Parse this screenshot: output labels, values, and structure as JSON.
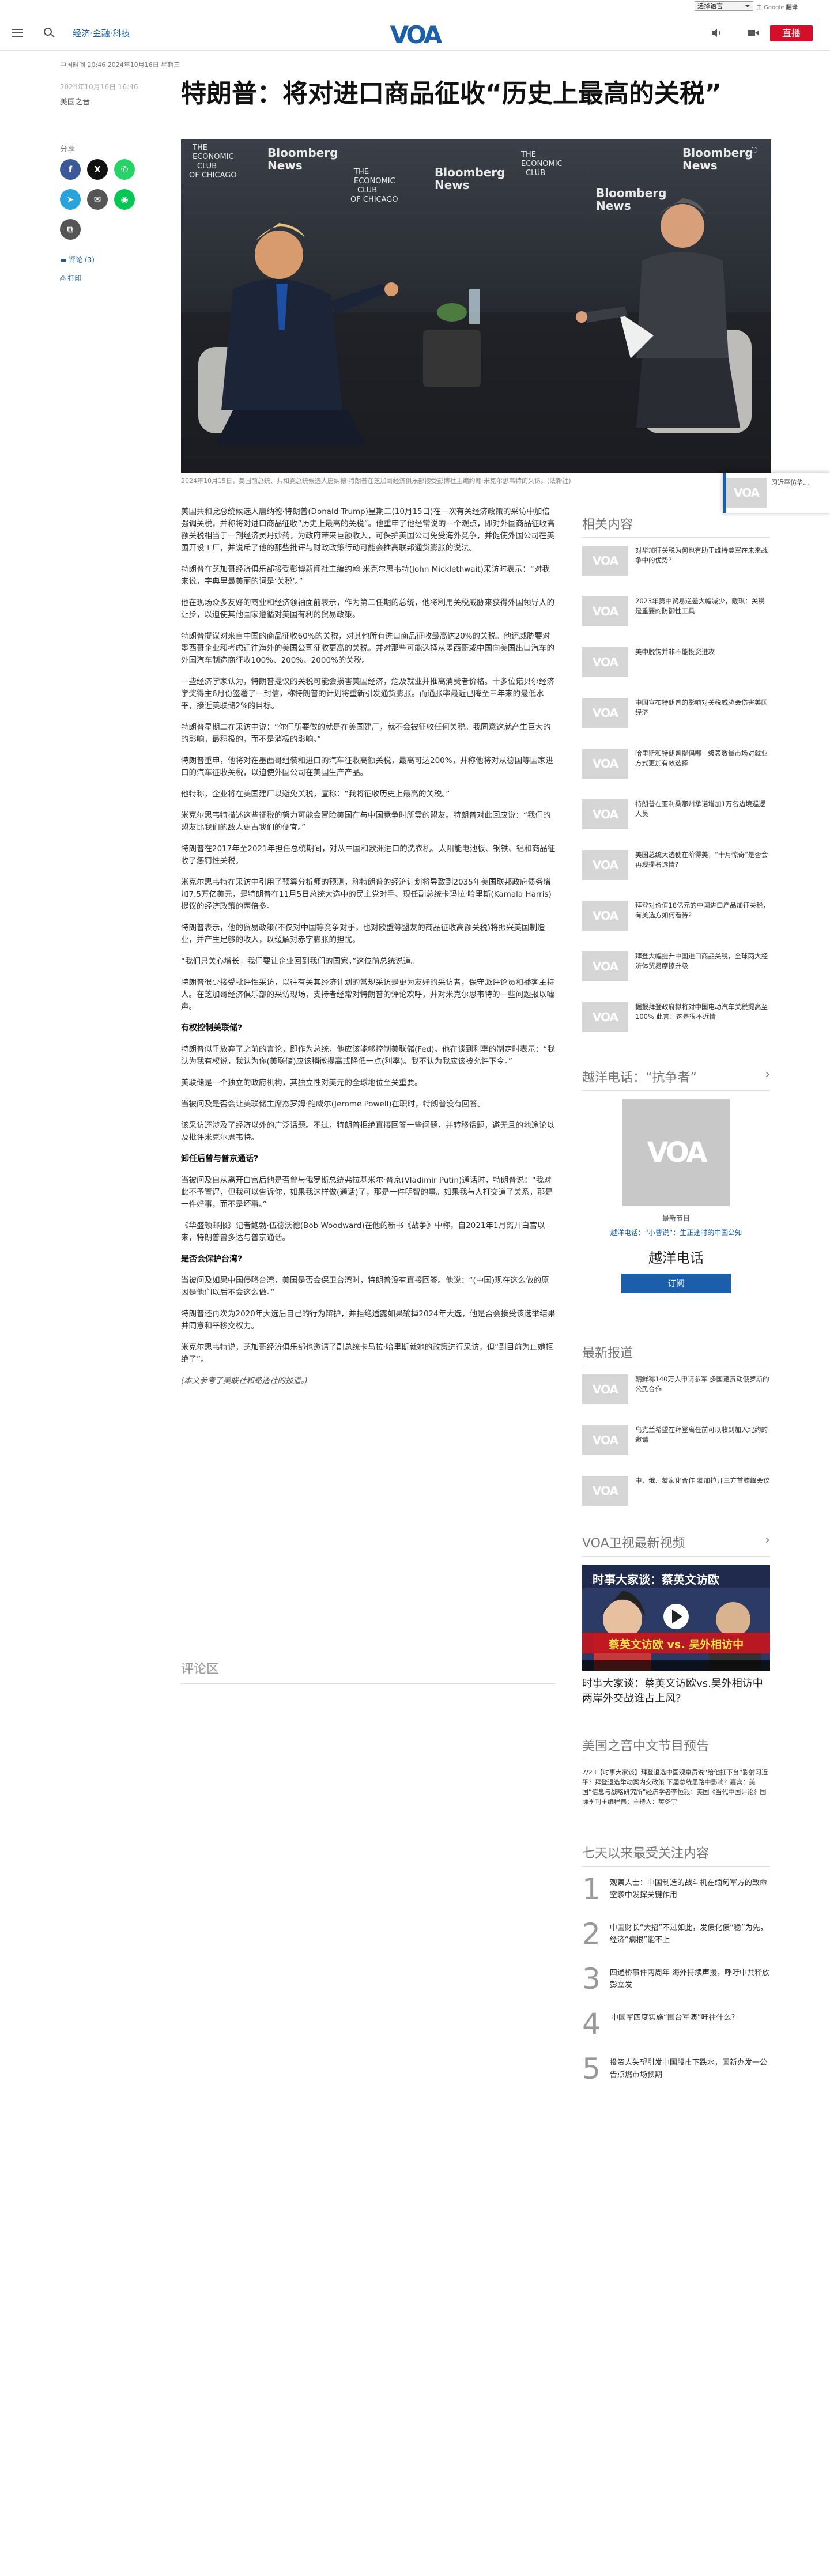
{
  "topbar": {
    "language_select": "选择语言",
    "google_by": "由 Google",
    "google_service": "翻译"
  },
  "header": {
    "breadcrumb": "经济·金融·科技",
    "logo": "VOA",
    "live_label": "直播"
  },
  "article": {
    "dateline": "中国时间 20:46 2024年10月16日 星期三",
    "publish_date": "2024年10月16日 16:46",
    "author": "美国之音",
    "title": "特朗普：将对进口商品征收“历史上最高的关税”",
    "share_label": "分享",
    "comments_link": "评论 (3)",
    "print_link": "打印",
    "photo_banner": {
      "brand1": "THE ECONOMIC CLUB OF CHICAGO",
      "brand2": "Bloomberg News",
      "sign": "Bloomberg"
    },
    "caption": "2024年10月15日，美国前总统、共和党总统候选人唐纳德·特朗普在芝加哥经济俱乐部接受彭博社主编约翰·米克尔思韦特的采访。(法新社)",
    "paragraphs": [
      "美国共和党总统候选人唐纳德·特朗普(Donald Trump)星期二(10月15日)在一次有关经济政策的采访中加倍强调关税，并称将对进口商品征收“历史上最高的关税”。他重申了他经常说的一个观点，即对外国商品征收高额关税相当于一剂经济灵丹妙药，为政府带来巨额收入，可保护美国公司免受海外竞争，并促使外国公司在美国开设工厂，并说斥了他的那些批评与财政政策行动可能会推高联邦通货膨胀的说法。",
      "特朗普在芝加哥经济俱乐部接受彭博新闻社主编约翰·米克尔思韦特(John Micklethwait)采访时表示：“对我来说，字典里最美丽的词是‘关税’。”",
      "他在现场众多友好的商业和经济领袖面前表示，作为第二任期的总统，他将利用关税威胁来获得外国领导人的让步，以迫使其他国家遵循对美国有利的贸易政策。",
      "特朗普提议对来自中国的商品征收60%的关税，对其他所有进口商品征收最高达20%的关税。他还威胁要对墨西哥企业和考虑迁往海外的美国公司征收更高的关税。并对那些可能选择从墨西哥或中国向美国出口汽车的外国汽车制造商征收100%、200%、2000%的关税。",
      "一些经济学家认为，特朗普提议的关税可能会损害美国经济，危及就业并推高消费者价格。十多位诺贝尔经济学奖得主6月份签署了一封信，称特朗普的计划将重新引发通货膨胀。而通胀率最近已降至三年来的最低水平，接近美联储2%的目标。",
      "特朗普星期二在采访中说：“你们所要做的就是在美国建厂，就不会被征收任何关税。我同意这就产生巨大的的影响，最积极的，而不是消极的影响。”",
      "特朗普重申，他将对在墨西哥组装和进口的汽车征收高额关税，最高可达200%，并称他将对从德国等国家进口的汽车征收关税，以迫使外国公司在美国生产产品。",
      "他特称，企业将在美国建厂以避免关税，宣称：“我将征收历史上最高的关税。”",
      "米克尔思韦特描述这些征税的努力可能会冒险美国在与中国竞争时所需的盟友。特朗普对此回应说：“我们的盟友比我们的敌人更占我们的便宜。”",
      "特朗普在2017年至2021年担任总统期间，对从中国和欧洲进口的洗衣机、太阳能电池板、钢铁、铝和商品征收了惩罚性关税。",
      "米克尔思韦特在采访中引用了预算分析师的预测，称特朗普的经济计划将导致到2035年美国联邦政府债务增加7.5万亿美元，是特朗普在11月5日总统大选中的民主党对手、现任副总统卡玛拉·哈里斯(Kamala Harris)提议的经济政策的两倍多。",
      "特朗普表示，他的贸易政策(不仅对中国等竞争对手，也对欧盟等盟友的商品征收高额关税)将振兴美国制造业，并产生足够的收入，以缓解对赤字膨胀的担忧。",
      "“我们只关心增长。我们要让企业回到我们的国家，”这位前总统说道。",
      "特朗普很少接受批评性采访，以往有关其经济计划的常规采访是更为友好的采访者，保守派评论员和播客主持人。在芝加哥经济俱乐部的采访现场，支持者经常对特朗普的评论欢呼，并对米克尔思韦特的一些问题报以嘘声。"
    ],
    "h_fed": "有权控制美联储?",
    "paragraphs2": [
      "特朗普似乎放弃了之前的言论，即作为总统，他应该能够控制美联储(Fed)。他在谈到利率的制定时表示：“我认为我有权说，我认为你(美联储)应该稍微提高或降低一点(利率)。我不认为我应该被允许下令。”",
      "美联储是一个独立的政府机构，其独立性对美元的全球地位至关重要。",
      "当被问及是否会让美联储主席杰罗姆·鲍威尔(Jerome Powell)在职时，特朗普没有回答。",
      "该采访还涉及了经济以外的广泛话题。不过，特朗普拒绝直接回答一些问题，并转移话题，避无且的地途论以及批评米克尔思韦特。"
    ],
    "h_putin": "卸任后曾与普京通话?",
    "paragraphs3": [
      "当被问及自从离开白宫后他是否曾与俄罗斯总统弗拉基米尔·普京(Vladimir Putin)通话时，特朗普说：“我对此不予置评，但我可以告诉你，如果我这样做(通话)了，那是一件明智的事。如果我与人打交道了关系，那是一件好事，而不是坏事。”",
      "《华盛顿邮报》记者鲍勃·伍德沃德(Bob Woodward)在他的新书《战争》中称，自2021年1月离开白宫以来，特朗普曾多达与普京通话。"
    ],
    "h_taiwan": "是否会保护台湾?",
    "paragraphs4": [
      "当被问及如果中国侵略台湾，美国是否会保卫台湾时，特朗普没有直接回答。他说：“(中国)现在这么做的原因是他们以后不会这么做。”",
      "特朗普还再次为2020年大选后自己的行为辩护，并拒绝透露如果输掉2024年大选，他是否会接受该选举结果并同意和平移交权力。",
      "米克尔思韦特说，芝加哥经济俱乐部也邀请了副总统卡马拉·哈里斯就她的政策进行采访，但“到目前为止她拒绝了”。"
    ],
    "source_note": "(本文参考了美联社和路透社的报道。)",
    "comments_title": "评论区"
  },
  "rail": {
    "related_title": "相关内容",
    "related": [
      "对华加征关税为何也有助于维持美军在未来战争中的优势?",
      "2023年第中贸易逆差大幅减少，戴琪：关税是重要的防御性工具",
      "美中脱钩并非不能投资进攻",
      "中国宣布特朗普的影响对关税威胁会伤害美国经济",
      "哈里斯和特朗普提倡哪一级表数量市场对就业方式更加有效选择",
      "特朗普在亚利桑那州承诺增加1万名边境巡逻人员",
      "美国总统大选使在阶得美，“十月惊奇”是否会再现提名选情?",
      "拜登对价值18亿元的中国进口产品加征关税，有美选方如何看待?",
      "拜登大幅提升中国进口商品关税，全球两大经济体贸易摩擦升级",
      "据报拜登政府拟将对中国电动汽车关税提高至100% 此言：这是很不近情"
    ],
    "program_title": "越洋电话：“抗争者”",
    "program_label": "最新节目",
    "program_link": "越洋电话：“小曹说”：生正逢时的中国公知",
    "program_name": "越洋电话",
    "subscribe": "订阅",
    "latest_title": "最新报道",
    "latest": [
      "朝鲜称140万人申请参军 多国谴责动俄罗斯的公民合作",
      "乌克兰希望在拜登离任前可以收到加入北约的邀请",
      "中、俄、蒙家化合作 蒙加拉开三方首脑峰会议"
    ],
    "video_title": "VOA卫视最新视频",
    "video_banner": "时事大家谈：蔡英文访欧",
    "video_subtitle": "蔡英文访欧 vs. 吴外相访中",
    "video_caption": "时事大家谈：蔡英文访欧vs.吴外相访中 两岸外交战谁占上风?",
    "yearbook_title": "美国之音中文节目预告",
    "yearbook_text": "7/23【时事大家谈】拜登退选中国观察员说“给他扛下台”影射习近平？拜登退选举动案内交政策 下届总统思路中影响？嘉宾：美国“信息与战略研究所”经济学者李恒毅；美国《当代中国评论》国际季刊主编程伟；主持人：樊冬宁",
    "popular_title": "七天以来最受关注内容",
    "popular": [
      "观察人士：中国制造的战斗机在缅甸军方的致命空袭中发挥关键作用",
      "中国财长“大招”不过如此，发债化债“稳”为先，经济“病根”能不上",
      "四通桥事件两周年 海外持续声援，呼吁中共释放彭立发",
      "中国军四度实施“围台军演”吁往什么?",
      "投资人失望引发中国股市下跌水，国新办发一公告点燃市场预期"
    ],
    "float_text": "习近平仿华..."
  },
  "colors": {
    "accent": "#1b5faa",
    "live": "#d50f2a"
  }
}
